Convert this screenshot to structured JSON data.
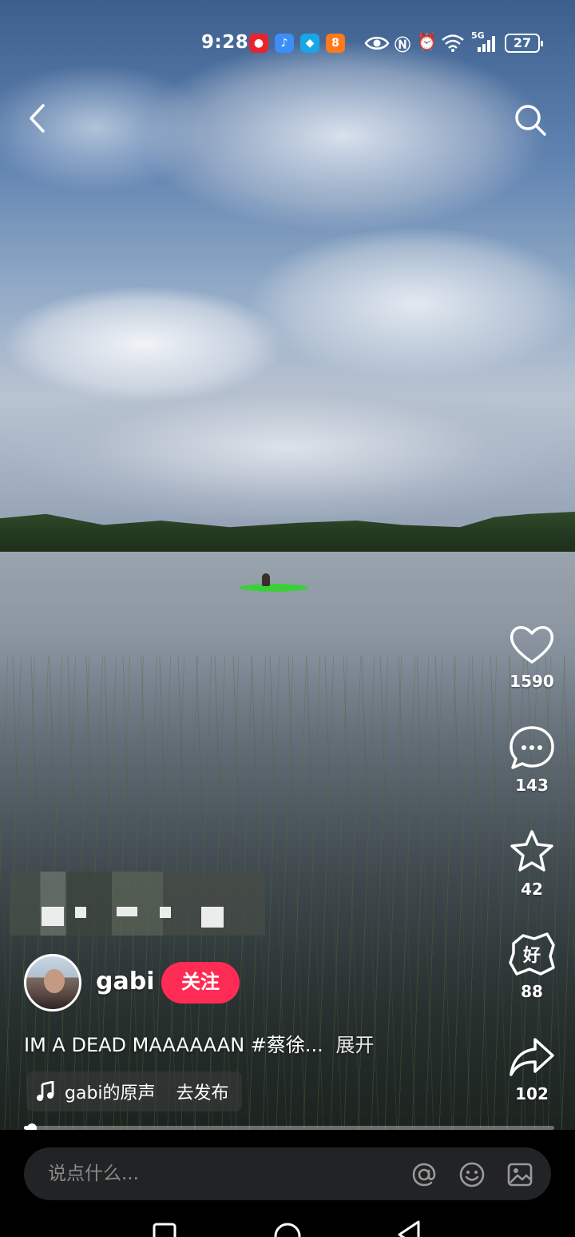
{
  "status_bar": {
    "time": "9:28",
    "app_icons": [
      {
        "name": "weibo-app-icon",
        "color": "#e8232d",
        "glyph": "●"
      },
      {
        "name": "music-app-icon",
        "color": "#3d8ef7",
        "glyph": "♪"
      },
      {
        "name": "browser-app-icon",
        "color": "#17a6e6",
        "glyph": "◆"
      },
      {
        "name": "shop-app-icon",
        "color": "#ff7a1a",
        "glyph": "8"
      }
    ],
    "network": "5G",
    "battery": "27"
  },
  "video": {
    "caption_text": "IM A DEAD MAAAAAAN",
    "hashtag": "#蔡徐...",
    "expand_label": "展开",
    "progress": 0.015
  },
  "author": {
    "username": "gabi",
    "follow_label": "关注"
  },
  "rail": {
    "likes": "1590",
    "comments": "143",
    "favorites": "42",
    "good": "88",
    "shares": "102"
  },
  "music": {
    "title": "gabi的原声",
    "publish_label": "去发布"
  },
  "comment_bar": {
    "placeholder": "说点什么..."
  }
}
